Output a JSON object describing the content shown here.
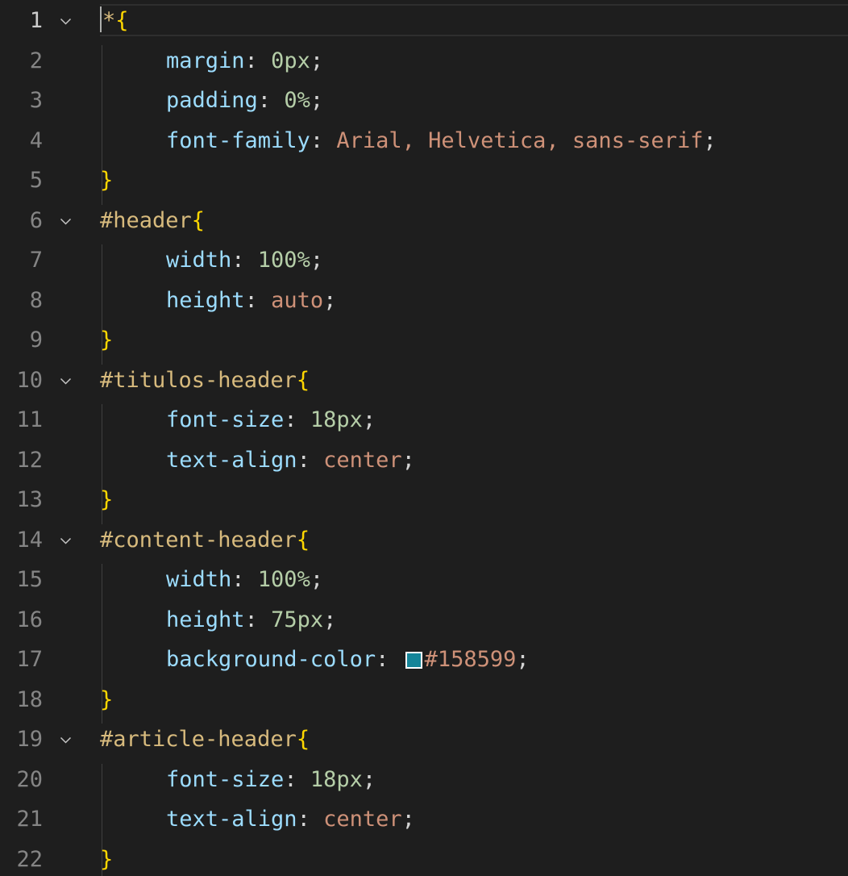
{
  "editor": {
    "active_line": "1",
    "lines": [
      {
        "num": "1",
        "fold": true,
        "selector": "*",
        "open": "{"
      },
      {
        "num": "2",
        "prop": "margin",
        "value": "0px",
        "value_type": "number"
      },
      {
        "num": "3",
        "prop": "padding",
        "value": "0%",
        "value_type": "number"
      },
      {
        "num": "4",
        "prop": "font-family",
        "value": "Arial, Helvetica, sans-serif",
        "value_type": "string"
      },
      {
        "num": "5",
        "close": "}"
      },
      {
        "num": "6",
        "fold": true,
        "selector": "#header",
        "open": "{"
      },
      {
        "num": "7",
        "prop": "width",
        "value": "100%",
        "value_type": "number"
      },
      {
        "num": "8",
        "prop": "height",
        "value": "auto",
        "value_type": "string"
      },
      {
        "num": "9",
        "close": "}"
      },
      {
        "num": "10",
        "fold": true,
        "selector": "#titulos-header",
        "open": "{"
      },
      {
        "num": "11",
        "prop": "font-size",
        "value": "18px",
        "value_type": "number"
      },
      {
        "num": "12",
        "prop": "text-align",
        "value": "center",
        "value_type": "string"
      },
      {
        "num": "13",
        "close": "}"
      },
      {
        "num": "14",
        "fold": true,
        "selector": "#content-header",
        "open": "{"
      },
      {
        "num": "15",
        "prop": "width",
        "value": "100%",
        "value_type": "number"
      },
      {
        "num": "16",
        "prop": "height",
        "value": "75px",
        "value_type": "number"
      },
      {
        "num": "17",
        "prop": "background-color",
        "value": "#158599",
        "value_type": "color",
        "swatch": "#158599"
      },
      {
        "num": "18",
        "close": "}"
      },
      {
        "num": "19",
        "fold": true,
        "selector": "#article-header",
        "open": "{"
      },
      {
        "num": "20",
        "prop": "font-size",
        "value": "18px",
        "value_type": "number"
      },
      {
        "num": "21",
        "prop": "text-align",
        "value": "center",
        "value_type": "string"
      },
      {
        "num": "22",
        "close": "}"
      }
    ]
  },
  "colors": {
    "background": "#1e1e1e",
    "line_number": "#858585",
    "line_number_active": "#cccccc",
    "selector": "#d7ba7d",
    "brace": "#ffd700",
    "property": "#9cdcfe",
    "number": "#b5cea8",
    "string": "#ce9178",
    "punctuation": "#d4d4d4"
  },
  "icons": {
    "fold": "chevron-down-icon"
  }
}
